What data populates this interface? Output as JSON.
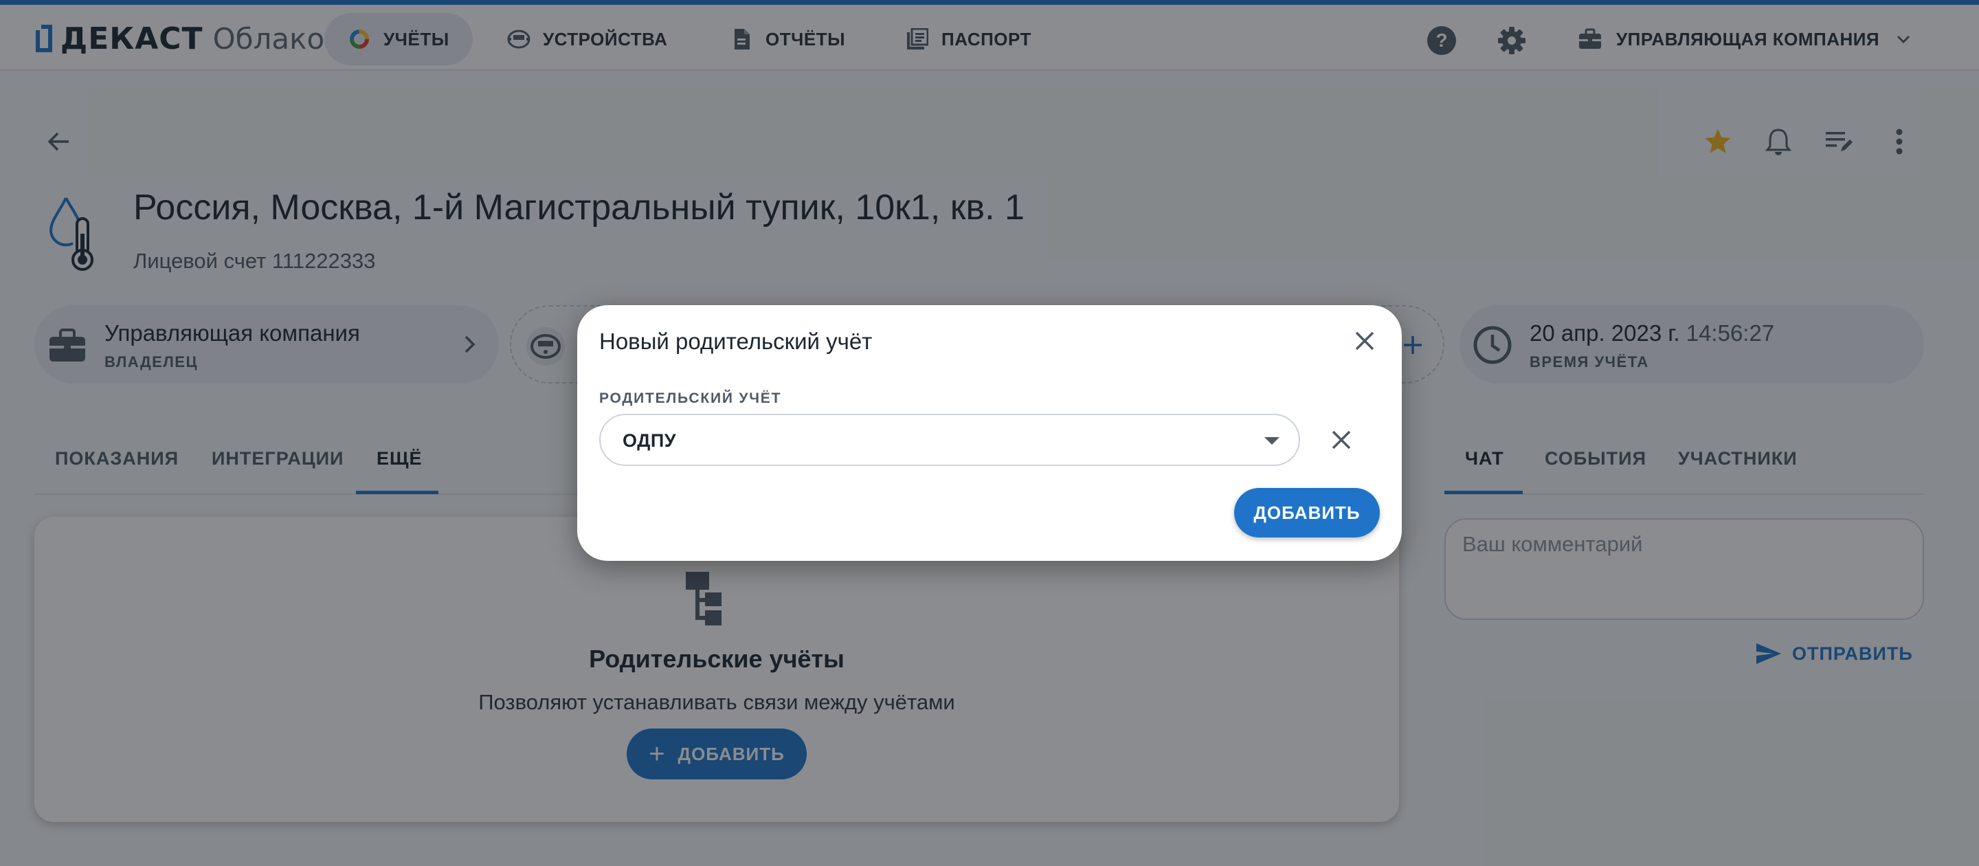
{
  "app": {
    "logo_word": "ДЕКАСТ",
    "logo_sub": "Облако"
  },
  "nav": [
    {
      "label": "УЧЁТЫ",
      "icon": "colorful-circle-icon",
      "active": true
    },
    {
      "label": "УСТРОЙСТВА",
      "icon": "meter-device-icon",
      "active": false
    },
    {
      "label": "ОТЧЁТЫ",
      "icon": "document-icon",
      "active": false
    },
    {
      "label": "ПАСПОРТ",
      "icon": "passport-library-icon",
      "active": false
    }
  ],
  "topbar": {
    "help_icon": "help-icon",
    "settings_icon": "gear-icon",
    "company_label": "УПРАВЛЯЮЩАЯ КОМПАНИЯ",
    "company_icon": "briefcase-icon",
    "company_chevron": "chevron-down-icon"
  },
  "page": {
    "address": "Россия, Москва, 1-й Магистральный тупик, 10к1, кв. 1",
    "account": "Лицевой счет 111222333"
  },
  "chips": {
    "owner": {
      "title": "Управляющая компания",
      "sub": "ВЛАДЕЛЕЦ"
    },
    "time": {
      "date": "20 апр. 2023 г.",
      "time": "14:56:27",
      "sub": "ВРЕМЯ УЧЁТА"
    }
  },
  "tabs_left": [
    "ПОКАЗАНИЯ",
    "ИНТЕГРАЦИИ",
    "ЕЩЁ"
  ],
  "tabs_right": [
    "ЧАТ",
    "СОБЫТИЯ",
    "УЧАСТНИКИ"
  ],
  "card": {
    "title": "Родительские учёты",
    "description": "Позволяют устанавливать связи между учётами",
    "button_label": "ДОБАВИТЬ"
  },
  "chat": {
    "placeholder": "Ваш комментарий",
    "send_label": "ОТПРАВИТЬ"
  },
  "dialog": {
    "title": "Новый родительский учёт",
    "field_label": "РОДИТЕЛЬСКИЙ УЧЁТ",
    "field_value": "ОДПУ",
    "add_label": "ДОБАВИТЬ"
  },
  "colors": {
    "accent": "#1f74c9",
    "star": "#f2b21b"
  }
}
